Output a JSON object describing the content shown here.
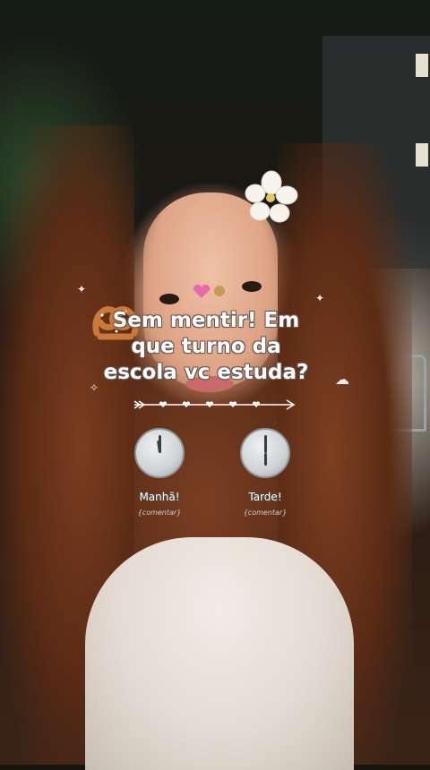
{
  "question": {
    "line1": "Sem mentir! Em",
    "line2": "que turno da",
    "line3": "escola vc estuda?"
  },
  "options": [
    {
      "label": "Manhã!",
      "sub": "{comentar}",
      "time": "12:00"
    },
    {
      "label": "Tarde!",
      "sub": "{comentar}",
      "time": "18:00"
    }
  ],
  "icons": [
    "pretzel-icon",
    "heart-divider-arrow",
    "clock-icon"
  ],
  "colors": {
    "text": "#ffffff",
    "outline": "#6b5d57",
    "clock_face": "#cfd3d6"
  }
}
